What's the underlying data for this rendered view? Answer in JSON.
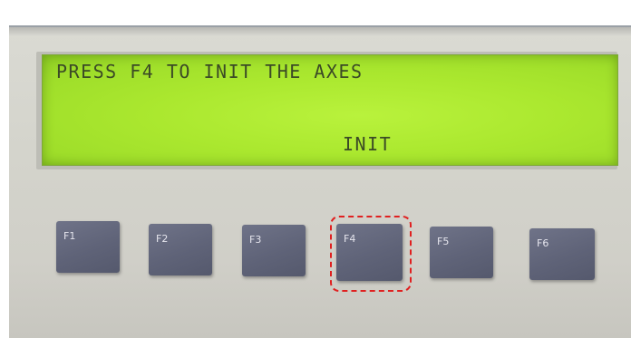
{
  "lcd": {
    "line1": "PRESS F4 TO INIT THE AXES",
    "softkey_label": "INIT"
  },
  "function_keys": [
    {
      "label": "F1"
    },
    {
      "label": "F2"
    },
    {
      "label": "F3"
    },
    {
      "label": "F4",
      "highlighted": true
    },
    {
      "label": "F5"
    },
    {
      "label": "F6"
    }
  ],
  "colors": {
    "lcd_background": "#abe82f",
    "lcd_text": "#3b4a26",
    "key_background": "#5f6378",
    "highlight": "#e02020",
    "panel": "#d4d4cc"
  }
}
